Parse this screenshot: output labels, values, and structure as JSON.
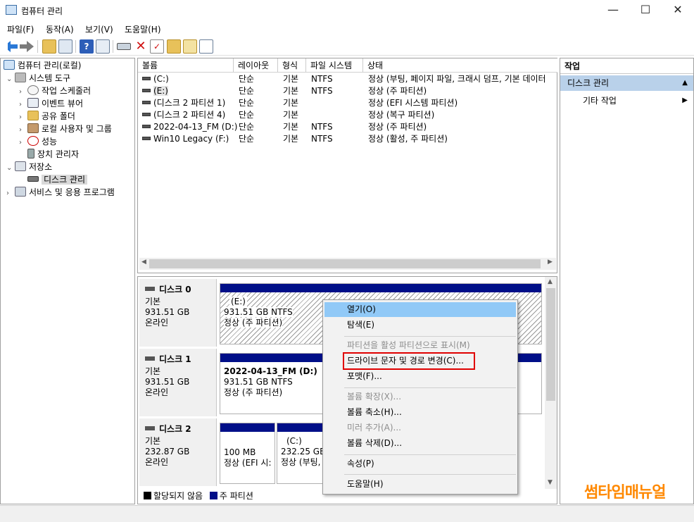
{
  "window": {
    "title": "컴퓨터 관리",
    "controls": {
      "minimize": "—",
      "maximize": "☐",
      "close": "✕"
    }
  },
  "menu": [
    "파일(F)",
    "동작(A)",
    "보기(V)",
    "도움말(H)"
  ],
  "toolbar": [
    "back-icon",
    "forward-icon",
    "up-folder-icon",
    "show-tree-icon",
    "help-icon",
    "properties-icon",
    "connect-icon",
    "delete-icon",
    "check-icon",
    "upload-icon",
    "search-icon",
    "list-icon"
  ],
  "tree": {
    "root": "컴퓨터 관리(로컬)",
    "system_tools": "시스템 도구",
    "task_scheduler": "작업 스케줄러",
    "event_viewer": "이벤트 뷰어",
    "shared_folders": "공유 폴더",
    "local_users": "로컬 사용자 및 그룹",
    "performance": "성능",
    "device_manager": "장치 관리자",
    "storage": "저장소",
    "disk_management": "디스크 관리",
    "services": "서비스 및 응용 프로그램"
  },
  "volume_list": {
    "columns": [
      "볼륨",
      "레이아웃",
      "형식",
      "파일 시스템",
      "상태"
    ],
    "rows": [
      {
        "volume": "(C:)",
        "layout": "단순",
        "type": "기본",
        "fs": "NTFS",
        "status": "정상 (부팅, 페이지 파일, 크래시 덤프, 기본 데이터"
      },
      {
        "volume": "(E:)",
        "layout": "단순",
        "type": "기본",
        "fs": "NTFS",
        "status": "정상 (주 파티션)"
      },
      {
        "volume": "(디스크 2 파티션 1)",
        "layout": "단순",
        "type": "기본",
        "fs": "",
        "status": "정상 (EFI 시스템 파티션)"
      },
      {
        "volume": "(디스크 2 파티션 4)",
        "layout": "단순",
        "type": "기본",
        "fs": "",
        "status": "정상 (복구 파티션)"
      },
      {
        "volume": "2022-04-13_FM (D:)",
        "layout": "단순",
        "type": "기본",
        "fs": "NTFS",
        "status": "정상 (주 파티션)"
      },
      {
        "volume": "Win10 Legacy (F:)",
        "layout": "단순",
        "type": "기본",
        "fs": "NTFS",
        "status": "정상 (활성, 주 파티션)"
      }
    ]
  },
  "disks": [
    {
      "name": "디스크 0",
      "kind": "기본",
      "size": "931.51 GB",
      "state": "온라인",
      "partitions": [
        {
          "label": "(E:)",
          "size": "931.51 GB NTFS",
          "status": "정상 (주 파티션)"
        }
      ]
    },
    {
      "name": "디스크 1",
      "kind": "기본",
      "size": "931.51 GB",
      "state": "온라인",
      "partitions": [
        {
          "label": "2022-04-13_FM  (D:)",
          "size": "931.51 GB NTFS",
          "status": "정상 (주 파티션)"
        }
      ]
    },
    {
      "name": "디스크 2",
      "kind": "기본",
      "size": "232.87 GB",
      "state": "온라인",
      "partitions": [
        {
          "label": "",
          "size": "100 MB",
          "status": "정상 (EFI 시:"
        },
        {
          "label": "(C:)",
          "size": "232.25 GB N",
          "status": "정상 (부팅,"
        }
      ]
    }
  ],
  "legend": {
    "unallocated": "할당되지 않음",
    "primary": "주 파티션",
    "colors": {
      "unallocated": "#000000",
      "primary": "#000f88"
    }
  },
  "actions": {
    "header": "작업",
    "section": "디스크 관리",
    "more": "기타 작업"
  },
  "context_menu": {
    "items": [
      {
        "label": "열기(O)",
        "state": "highlighted"
      },
      {
        "label": "탐색(E)",
        "state": "normal"
      },
      {
        "label": "파티션을 활성 파티션으로 표시(M)",
        "state": "disabled"
      },
      {
        "label": "드라이브 문자 및 경로 변경(C)...",
        "state": "normal"
      },
      {
        "label": "포맷(F)...",
        "state": "normal"
      },
      {
        "label": "볼륨 확장(X)...",
        "state": "disabled"
      },
      {
        "label": "볼륨 축소(H)...",
        "state": "normal"
      },
      {
        "label": "미러 추가(A)...",
        "state": "disabled"
      },
      {
        "label": "볼륨 삭제(D)...",
        "state": "normal"
      },
      {
        "label": "속성(P)",
        "state": "normal"
      },
      {
        "label": "도움말(H)",
        "state": "normal"
      }
    ]
  },
  "watermark": "썸타임매뉴얼",
  "colors": {
    "accent_highlight": "#91c9f7",
    "partition_bar": "#000f88",
    "annotation_box": "#e00000",
    "watermark": "#ff8800",
    "action_header": "#b9d1ea"
  }
}
